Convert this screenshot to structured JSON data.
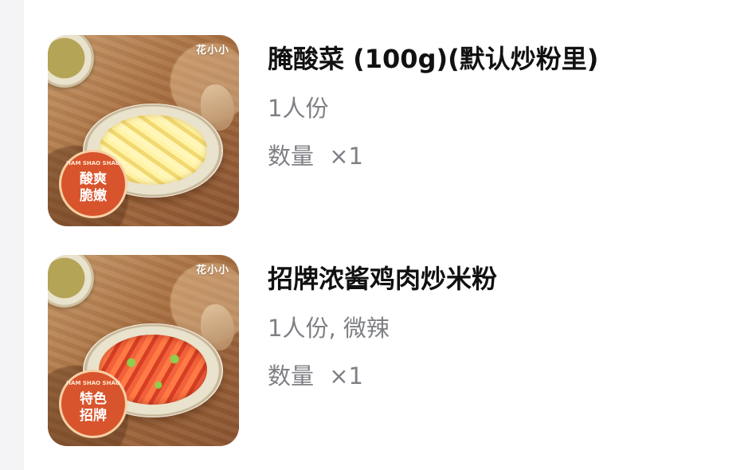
{
  "order_items": [
    {
      "thumbnail": {
        "brand": "花小小",
        "badge_small": "HAM SHAO SHAO",
        "badge_text": "酸爽\n脆嫩",
        "accent_color": "#d8542c"
      },
      "title": "腌酸菜 (100g)(默认炒粉里)",
      "meta": "1人份",
      "quantity_label": "数量",
      "quantity_value": "×1"
    },
    {
      "thumbnail": {
        "brand": "花小小",
        "badge_small": "HAM SHAO SHAO",
        "badge_text": "特色\n招牌",
        "accent_color": "#d8542c"
      },
      "title": "招牌浓酱鸡肉炒米粉",
      "meta": "1人份, 微辣",
      "quantity_label": "数量",
      "quantity_value": "×1"
    }
  ]
}
